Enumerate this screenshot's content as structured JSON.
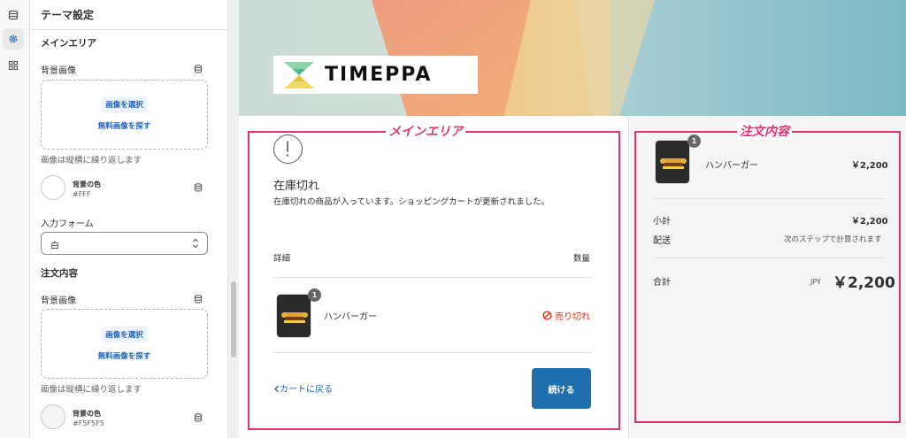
{
  "panel": {
    "title": "テーマ設定",
    "main_section": {
      "title": "メインエリア",
      "bg_image_label": "背景画像",
      "select_image": "画像を選択",
      "free_image": "無料画像を探す",
      "help": "画像は縦横に繰り返します",
      "color_name": "背景の色",
      "color_value": "#FFF",
      "form_label": "入力フォーム",
      "form_value": "白"
    },
    "order_section": {
      "title": "注文内容",
      "bg_image_label": "背景画像",
      "select_image": "画像を選択",
      "free_image": "無料画像を探す",
      "help": "画像は縦横に繰り返します",
      "color_name": "背景の色",
      "color_value": "#F5F5F5"
    }
  },
  "preview": {
    "logo": "TIMEPPA",
    "annotations": {
      "main": "メインエリア",
      "order": "注文内容"
    },
    "main": {
      "heading": "在庫切れ",
      "description": "在庫切れの商品が入っています。ショッピングカートが更新されました。",
      "col_detail": "詳細",
      "col_qty": "数量",
      "item": {
        "name": "ハンバーガー",
        "qty": "1",
        "status": "売り切れ"
      },
      "back_link": "カートに戻る",
      "continue": "続ける"
    },
    "order": {
      "item": {
        "name": "ハンバーガー",
        "qty": "1",
        "price": "￥2,200"
      },
      "subtotal_label": "小計",
      "subtotal_value": "￥2,200",
      "shipping_label": "配送",
      "shipping_value": "次のステップで計算されます",
      "total_label": "合計",
      "currency": "JPY",
      "total_value": "￥2,200"
    }
  },
  "colors": {
    "accent_link": "#1a62c2",
    "annotation": "#e6336f",
    "continue_button": "#1f6fae",
    "sold_out": "#d72c0d",
    "order_background": "#F5F5F5"
  },
  "icons": [
    "layout-icon",
    "gear-icon",
    "apps-icon",
    "database-icon",
    "chevron-updown-icon",
    "warning-icon",
    "prohibited-icon",
    "chevron-left-icon"
  ]
}
